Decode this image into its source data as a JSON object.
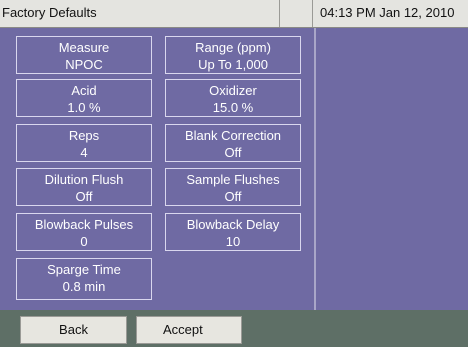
{
  "header": {
    "title": "Factory Defaults",
    "datetime": "04:13 PM Jan 12, 2010"
  },
  "settings": [
    {
      "label": "Measure",
      "value": "NPOC"
    },
    {
      "label": "Range (ppm)",
      "value": "Up To 1,000"
    },
    {
      "label": "Acid",
      "value": "1.0 %"
    },
    {
      "label": "Oxidizer",
      "value": "15.0 %"
    },
    {
      "label": "Reps",
      "value": "4"
    },
    {
      "label": "Blank Correction",
      "value": "Off"
    },
    {
      "label": "Dilution Flush",
      "value": "Off"
    },
    {
      "label": "Sample Flushes",
      "value": "Off"
    },
    {
      "label": "Blowback Pulses",
      "value": "0"
    },
    {
      "label": "Blowback Delay",
      "value": "10"
    },
    {
      "label": "Sparge Time",
      "value": "0.8 min"
    }
  ],
  "footer": {
    "back_label": "Back",
    "accept_label": "Accept"
  },
  "colors": {
    "panel_background": "#6f6aa3",
    "title_background": "#e4e4e0",
    "footer_background": "#5e6f66",
    "button_background": "#e7e6e0"
  }
}
